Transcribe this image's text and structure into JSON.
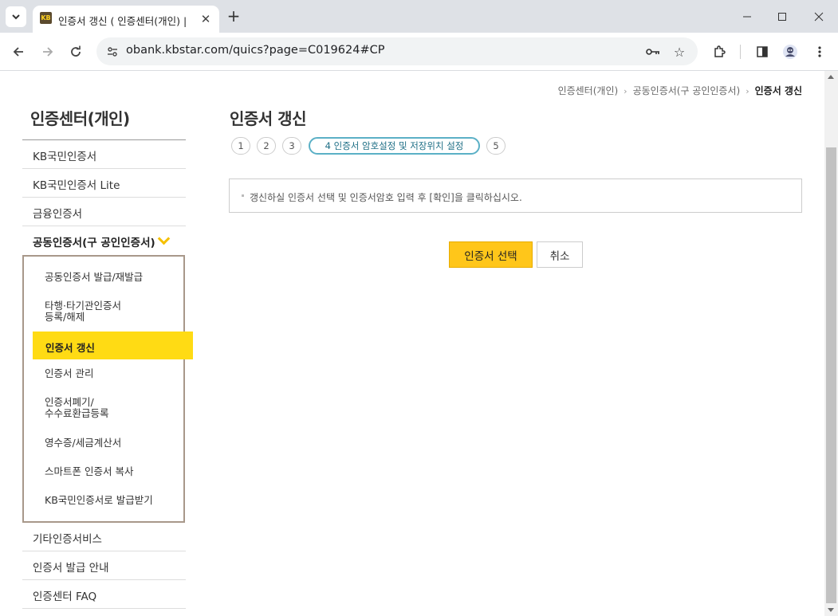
{
  "browser": {
    "tab_title": "인증서 갱신 ( 인증센터(개인) |",
    "favicon_text": "KB",
    "url": "obank.kbstar.com/quics?page=C019624#CP",
    "icons": [
      "tab-search-icon",
      "close-icon",
      "plus-icon",
      "minimize-icon",
      "maximize-icon",
      "window-close-icon",
      "back-arrow-icon",
      "forward-arrow-icon",
      "reload-icon",
      "site-info-icon",
      "key-icon",
      "star-icon",
      "extensions-icon",
      "side-panel-icon",
      "profile-avatar-icon",
      "kebab-menu-icon"
    ]
  },
  "breadcrumb": {
    "items": [
      "인증센터(개인)",
      "공동인증서(구 공인인증서)",
      "인증서 갱신"
    ]
  },
  "sidebar": {
    "title": "인증센터(개인)",
    "items_top": [
      "KB국민인증서",
      "KB국민인증서 Lite",
      "금융인증서"
    ],
    "open_item": "공동인증서(구 공인인증서)",
    "submenu": [
      "공동인증서 발급/재발급",
      "타행·타기관인증서 등록/해제",
      "인증서 갱신",
      "인증서 관리",
      "인증서폐기/ 수수료환급등록",
      "영수증/세금계산서",
      "스마트폰 인증서 복사",
      "KB국민인증서로 발급받기"
    ],
    "submenu_lines": {
      "item2": [
        "타행·타기관인증서",
        "등록/해제"
      ],
      "item5": [
        "인증서폐기/",
        "수수료환급등록"
      ]
    },
    "submenu_active": "인증서 갱신",
    "items_bottom": [
      "기타인증서비스",
      "인증서 발급 안내",
      "인증센터 FAQ"
    ]
  },
  "main": {
    "title": "인증서 갱신",
    "steps": [
      "1",
      "2",
      "3",
      "4 인증서 암호설정 및 저장위치 설정",
      "5"
    ],
    "active_step": "4 인증서 암호설정 및 저장위치 설정",
    "info": "갱신하실 인증서 선택 및 인증서암호 입력 후 [확인]을 클릭하십시오.",
    "select_button": "인증서 선택",
    "cancel_button": "취소"
  },
  "colors": {
    "accent": "#ffdb14",
    "button_primary": "#ffc61a",
    "step_active_border": "#5bb0c6"
  }
}
